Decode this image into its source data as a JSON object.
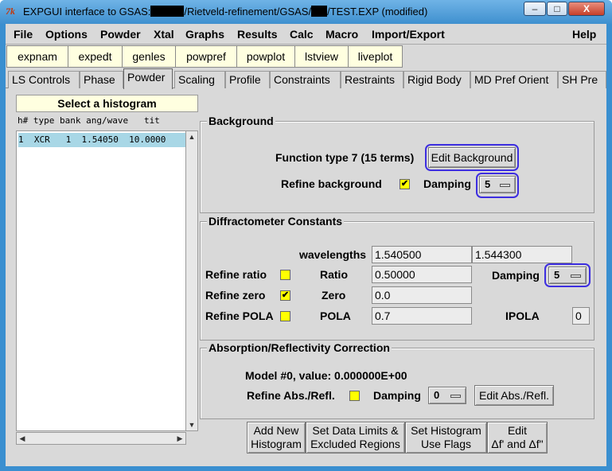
{
  "window": {
    "title_prefix": "EXPGUI interface to GSAS:",
    "title_path1": "/Rietveld-refinement/GSAS/",
    "title_path2": "/TEST.EXP (modified)",
    "app_icon": "7k",
    "minimize": "–",
    "maximize": "□",
    "close": "X"
  },
  "menu": [
    "File",
    "Options",
    "Powder",
    "Xtal",
    "Graphs",
    "Results",
    "Calc",
    "Macro",
    "Import/Export",
    "Help"
  ],
  "toolbar": [
    "expnam",
    "expedt",
    "genles",
    "powpref",
    "powplot",
    "lstview",
    "liveplot"
  ],
  "tabs": [
    "LS Controls",
    "Phase",
    "Powder",
    "Scaling",
    "Profile",
    "Constraints",
    "Restraints",
    "Rigid Body",
    "MD Pref Orient",
    "SH Pre"
  ],
  "active_tab": "Powder",
  "histogram_panel": {
    "title": "Select a histogram",
    "columns": "h# type bank ang/wave   tit",
    "rows": [
      "1  XCR   1  1.54050  10.0000"
    ]
  },
  "background": {
    "title": "Background",
    "function_text": "Function type 7  (15 terms)",
    "edit_button": "Edit Background",
    "refine_label": "Refine background",
    "refine_checked": true,
    "damping_label": "Damping",
    "damping_value": "5"
  },
  "diffractometer": {
    "title": "Diffractometer Constants",
    "wavelengths_label": "wavelengths",
    "wavelength1": "1.540500",
    "wavelength2": "1.544300",
    "refine_ratio_label": "Refine ratio",
    "refine_ratio_checked": false,
    "ratio_label": "Ratio",
    "ratio_value": "0.50000",
    "damping_label": "Damping",
    "damping_value": "5",
    "refine_zero_label": "Refine zero",
    "refine_zero_checked": true,
    "zero_label": "Zero",
    "zero_value": "0.0",
    "refine_pola_label": "Refine POLA",
    "refine_pola_checked": false,
    "pola_label": "POLA",
    "pola_value": "0.7",
    "ipola_label": "IPOLA",
    "ipola_value": "0"
  },
  "absorption": {
    "title": "Absorption/Reflectivity Correction",
    "model_text": "Model #0, value: 0.000000E+00",
    "refine_label": "Refine Abs./Refl.",
    "refine_checked": false,
    "damping_label": "Damping",
    "damping_value": "0",
    "edit_button": "Edit Abs./Refl."
  },
  "bottom_buttons": [
    {
      "line1": "Add New",
      "line2": "Histogram"
    },
    {
      "line1": "Set Data Limits &",
      "line2": "Excluded Regions"
    },
    {
      "line1": "Set Histogram",
      "line2": "Use Flags"
    },
    {
      "line1": "Edit",
      "line2": "Δf' and Δf\""
    }
  ],
  "checkmark": "✔",
  "colors": {
    "highlight": "#3d2ee0",
    "checkbox": "#ffff00",
    "panel_header": "#ffffe0",
    "selected_row": "#a8d7e6"
  }
}
